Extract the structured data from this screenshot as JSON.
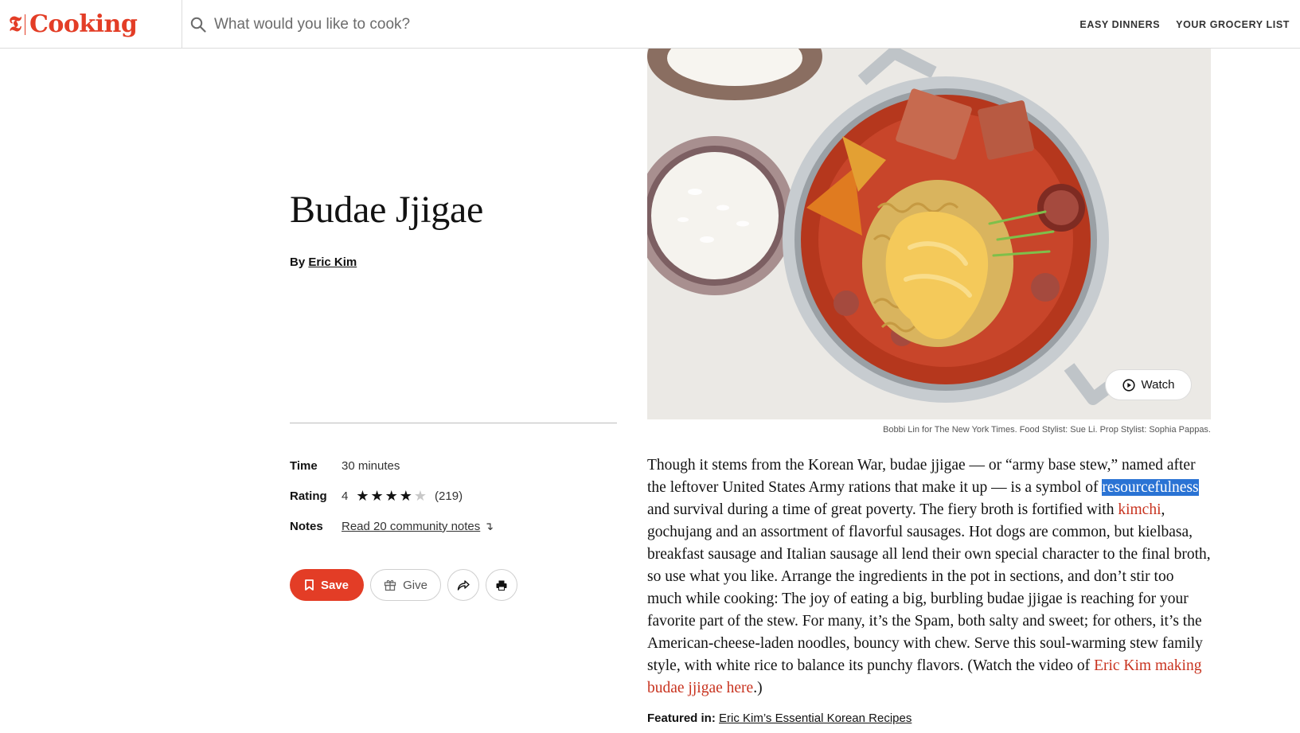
{
  "header": {
    "logo_t": "𝕿",
    "brand": "Cooking",
    "search_placeholder": "What would you like to cook?",
    "nav": [
      "EASY DINNERS",
      "YOUR GROCERY LIST"
    ]
  },
  "recipe": {
    "title": "Budae Jjigae",
    "by_prefix": "By",
    "author": "Eric Kim",
    "time_label": "Time",
    "time_value": "30 minutes",
    "rating_label": "Rating",
    "rating_value": "4",
    "rating_stars": 4,
    "rating_count": "(219)",
    "notes_label": "Notes",
    "notes_link": "Read 20 community notes"
  },
  "actions": {
    "save": "Save",
    "give": "Give"
  },
  "media": {
    "watch_label": "Watch",
    "credit": "Bobbi Lin for The New York Times. Food Stylist: Sue Li. Prop Stylist: Sophia Pappas."
  },
  "description": {
    "p1": "Though it stems from the Korean War, budae jjigae — or “army base stew,” named after the leftover United States Army rations that make it up — is a symbol of ",
    "highlight": "resourcefulness",
    "p2": " and survival during a time of great poverty. The fiery broth is fortified with ",
    "link1": "kimchi",
    "p3": ", gochujang and an assortment of flavorful sausages. Hot dogs are common, but kielbasa, breakfast sausage and Italian sausage all lend their own special character to the final broth, so use what you like. Arrange the ingredients in the pot in sections, and don’t stir too much while cooking: The joy of eating a big, burbling budae jjigae is reaching for your favorite part of the stew. For many, it’s the Spam, both salty and sweet; for others, it’s the American-cheese-laden noodles, bouncy with chew. Serve this soul-warming stew family style, with white rice to balance its punchy flavors. (Watch the video of ",
    "link2": "Eric Kim making budae jjigae here",
    "p4": ".)"
  },
  "featured": {
    "label": "Featured in:",
    "link": "Eric Kim’s Essential Korean Recipes"
  },
  "colors": {
    "brand_red": "#e33d26",
    "link_red": "#c8331f",
    "selection_blue": "#2a73d4"
  }
}
